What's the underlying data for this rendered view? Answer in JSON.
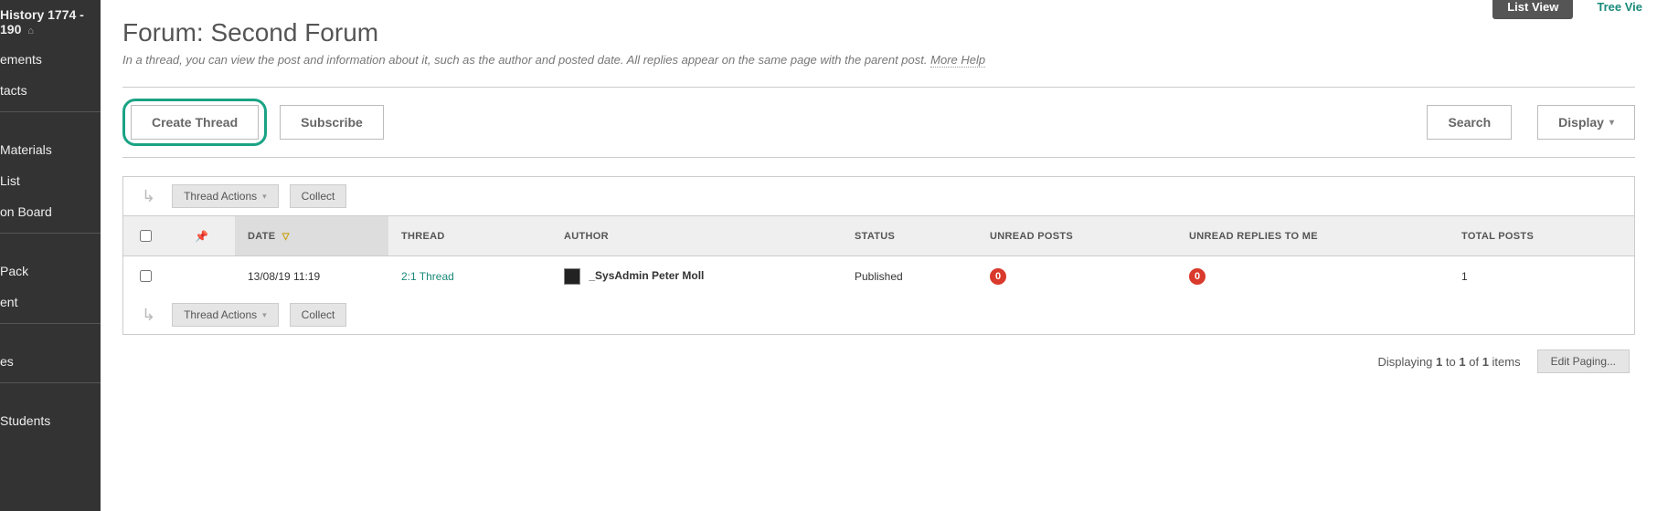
{
  "sidebar": {
    "course_title": "History 1774 - 190",
    "items": [
      {
        "label": "ements"
      },
      {
        "label": "tacts"
      }
    ],
    "items2": [
      {
        "label": "Materials"
      },
      {
        "label": "List"
      },
      {
        "label": "on Board"
      }
    ],
    "items3": [
      {
        "label": "Pack"
      },
      {
        "label": "ent"
      }
    ],
    "items4": [
      {
        "label": "es"
      }
    ],
    "items5": [
      {
        "label": "Students"
      }
    ]
  },
  "view_tabs": {
    "list_view": "List View",
    "tree_view": "Tree Vie"
  },
  "header": {
    "title": "Forum: Second Forum",
    "description": "In a thread, you can view the post and information about it, such as the author and posted date. All replies appear on the same page with the parent post.",
    "more_help": "More Help"
  },
  "toolbar": {
    "create_thread": "Create Thread",
    "subscribe": "Subscribe",
    "search": "Search",
    "display": "Display"
  },
  "thread_actions": {
    "label": "Thread Actions",
    "collect": "Collect"
  },
  "table": {
    "columns": {
      "date": "DATE",
      "thread": "THREAD",
      "author": "AUTHOR",
      "status": "STATUS",
      "unread_posts": "UNREAD POSTS",
      "unread_replies": "UNREAD REPLIES TO ME",
      "total_posts": "TOTAL POSTS"
    },
    "rows": [
      {
        "date": "13/08/19 11:19",
        "thread": "2:1 Thread",
        "author": "_SysAdmin Peter Moll",
        "status": "Published",
        "unread_posts": "0",
        "unread_replies": "0",
        "total_posts": "1"
      }
    ]
  },
  "paging": {
    "text_prefix": "Displaying ",
    "from": "1",
    "to_word": " to ",
    "to": "1",
    "of_word": " of ",
    "total": "1",
    "items_word": " items",
    "edit": "Edit Paging..."
  }
}
